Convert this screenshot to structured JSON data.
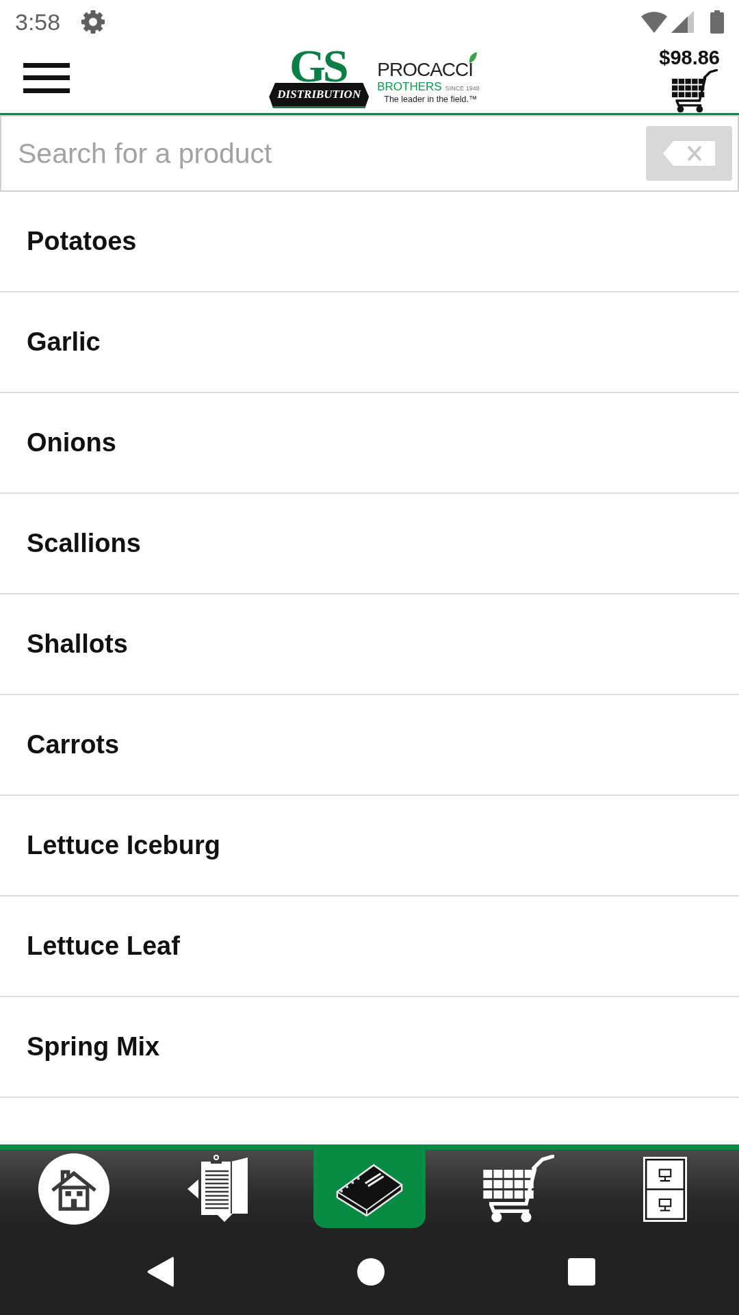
{
  "status_bar": {
    "time": "3:58"
  },
  "header": {
    "logo": {
      "mark": "GS",
      "banner": "DISTRIBUTION",
      "name": "PROCACCI",
      "subname": "BROTHERS",
      "since": "SINCE 1948",
      "tagline": "The leader in the field.™"
    },
    "cart_total": "$98.86"
  },
  "search": {
    "placeholder": "Search for a product"
  },
  "categories": [
    "Potatoes",
    "Garlic",
    "Onions",
    "Scallions",
    "Shallots",
    "Carrots",
    "Lettuce Iceburg",
    "Lettuce Leaf",
    "Spring Mix"
  ],
  "bottom_nav": [
    {
      "kind": "home",
      "selected": false
    },
    {
      "kind": "clipboard",
      "selected": false
    },
    {
      "kind": "book",
      "selected": true
    },
    {
      "kind": "cart",
      "selected": false
    },
    {
      "kind": "cabinet",
      "selected": false
    }
  ]
}
